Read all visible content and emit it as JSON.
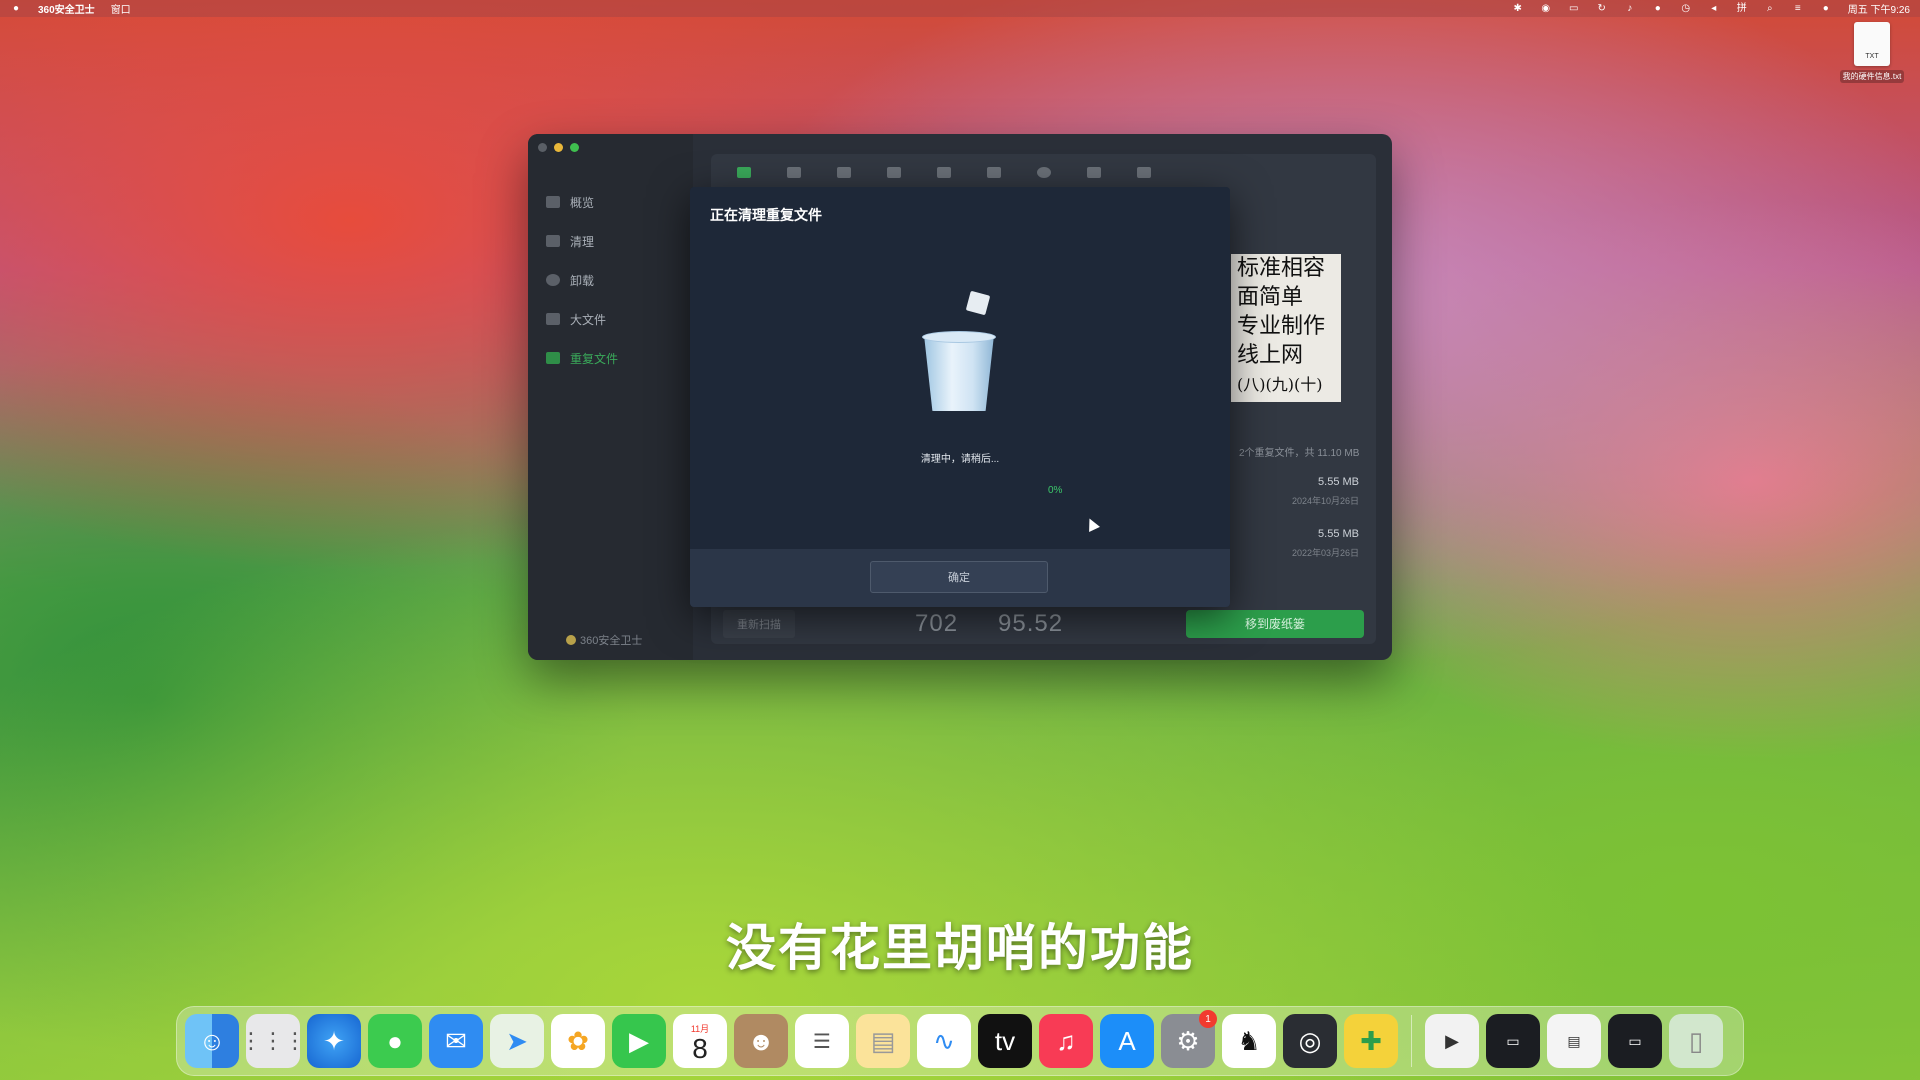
{
  "menubar": {
    "app_name": "360安全卫士",
    "menu_window": "窗口",
    "clock": "周五 下午9:26"
  },
  "desktop_file": {
    "badge": "TXT",
    "name": "我的硬件信息.txt"
  },
  "app": {
    "sidebar": {
      "items": [
        {
          "label": "概览"
        },
        {
          "label": "清理"
        },
        {
          "label": "卸载"
        },
        {
          "label": "大文件"
        },
        {
          "label": "重复文件"
        }
      ],
      "footer": "360安全卫士"
    },
    "preview_lines": [
      "标准相容",
      "面简单",
      "专业制作",
      "线上网",
      "(八)(九)(十)"
    ],
    "summary": "2个重复文件，共 11.10 MB",
    "rows": [
      {
        "size": "5.55 MB",
        "date": "2024年10月26日"
      },
      {
        "size": "5.55 MB",
        "date": "2022年03月26日"
      }
    ],
    "footer": {
      "rescan": "重新扫描",
      "stat1": "702",
      "stat2": "95.52",
      "move_to_trash": "移到废纸篓"
    }
  },
  "modal": {
    "title": "正在清理重复文件",
    "status": "清理中，请稍后...",
    "progress": "0%",
    "ok_button": "确定"
  },
  "subtitle": "没有花里胡哨的功能",
  "dock": {
    "calendar_month": "11月",
    "calendar_day": "8",
    "settings_badge": "1"
  }
}
